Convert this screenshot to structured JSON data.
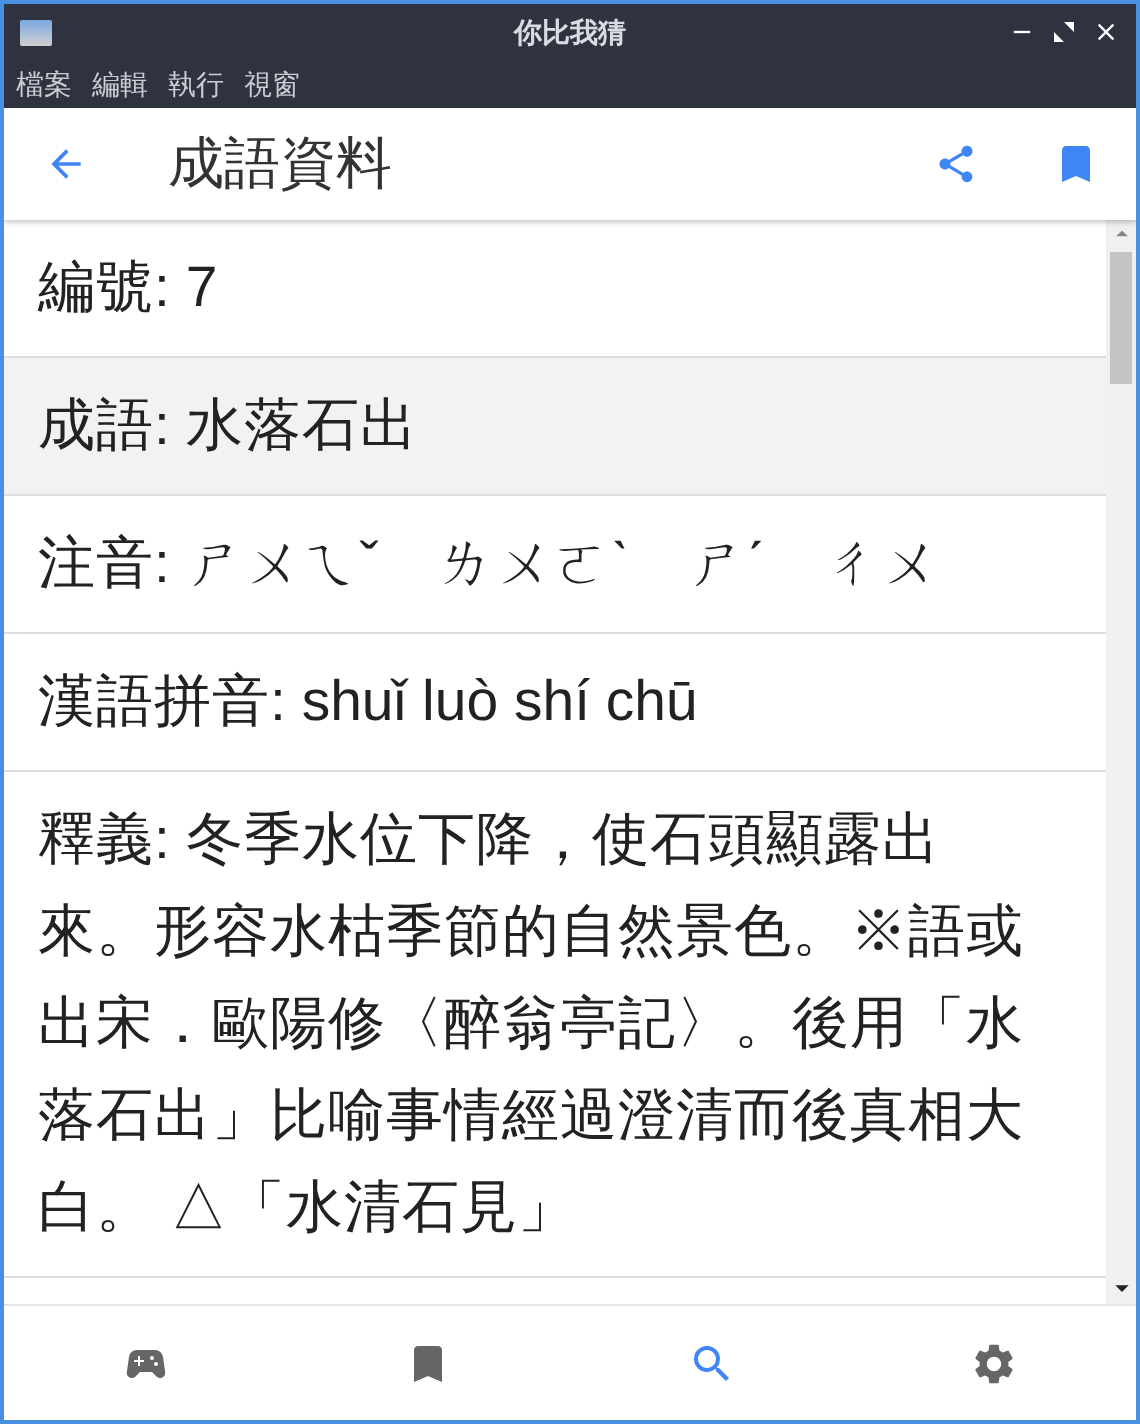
{
  "window": {
    "title": "你比我猜"
  },
  "menu": [
    "檔案",
    "編輯",
    "執行",
    "視窗"
  ],
  "header": {
    "title": "成語資料"
  },
  "rows": [
    {
      "text": "編號: 7",
      "selected": false
    },
    {
      "text": "成語: 水落石出",
      "selected": true
    },
    {
      "text": "注音: ㄕㄨㄟˇ　ㄌㄨㄛˋ　ㄕˊ　ㄔㄨ",
      "selected": false
    },
    {
      "text": "漢語拼音: shuǐ luò shí chū",
      "selected": false
    },
    {
      "text": "釋義: 冬季水位下降，使石頭顯露出來。形容水枯季節的自然景色。※語或出宋．歐陽修〈醉翁亭記〉。後用「水落石出」比喻事情經過澄清而後真相大白。 △「水清石見」",
      "selected": false
    }
  ],
  "nav": [
    {
      "kind": "game",
      "selected": false
    },
    {
      "kind": "bookmark",
      "selected": false
    },
    {
      "kind": "search",
      "selected": true
    },
    {
      "kind": "settings",
      "selected": false
    }
  ]
}
